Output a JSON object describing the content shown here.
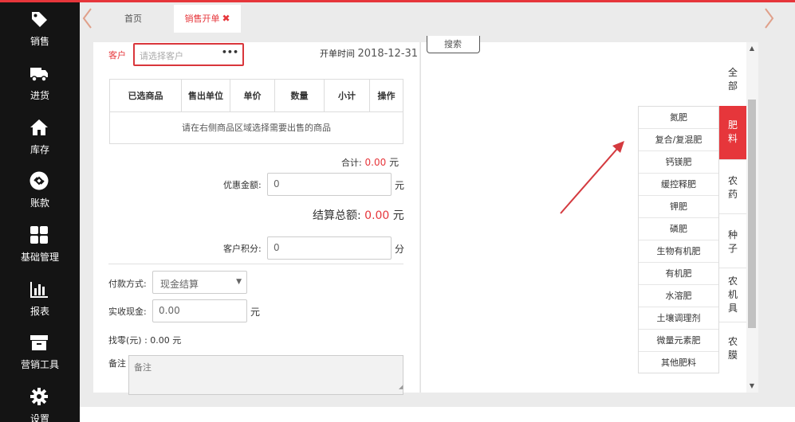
{
  "sidebar": {
    "items": [
      {
        "label": "销售",
        "icon": "tag-icon"
      },
      {
        "label": "进货",
        "icon": "truck-icon"
      },
      {
        "label": "库存",
        "icon": "home-icon"
      },
      {
        "label": "账款",
        "icon": "account-icon"
      },
      {
        "label": "基础管理",
        "icon": "grid-icon"
      },
      {
        "label": "报表",
        "icon": "bar-chart-icon"
      },
      {
        "label": "营销工具",
        "icon": "box-icon"
      },
      {
        "label": "设置",
        "icon": "gear-icon"
      }
    ]
  },
  "tabs": {
    "home": "首页",
    "active": "销售开单",
    "close": "✖"
  },
  "order": {
    "customer_label": "客户",
    "customer_placeholder": "请选择客户",
    "customer_more": "•••",
    "open_time_label": "开单时间",
    "open_time_value": "2018-12-31",
    "table": {
      "headers": [
        "已选商品",
        "售出单位",
        "单价",
        "数量",
        "小计",
        "操作"
      ],
      "empty_message": "请在右侧商品区域选择需要出售的商品"
    },
    "total_label": "合计:",
    "total_value": "0.00",
    "currency_unit": "元",
    "discount_label": "优惠金额:",
    "discount_value": "0",
    "settle_label": "结算总额:",
    "settle_value": "0.00",
    "points_label": "客户积分:",
    "points_value": "0",
    "points_unit": "分",
    "payment_label": "付款方式:",
    "payment_value": "现金结算",
    "cash_label": "实收现金:",
    "cash_value": "0.00",
    "change_label": "找零(元) : 0.00 元",
    "note_label": "备注",
    "note_placeholder": "备注"
  },
  "products": {
    "search_label": "搜索",
    "categories": [
      "全部",
      "肥料",
      "农药",
      "种子",
      "农机具",
      "农膜"
    ],
    "active_category": "肥料",
    "subcategories": [
      "氮肥",
      "复合/复混肥",
      "钙镁肥",
      "缓控释肥",
      "钾肥",
      "磷肥",
      "生物有机肥",
      "有机肥",
      "水溶肥",
      "土壤调理剂",
      "微量元素肥",
      "其他肥料"
    ]
  },
  "colors": {
    "accent": "#e6363b",
    "sidebar": "#141414",
    "arrow": "#d43a3f"
  }
}
